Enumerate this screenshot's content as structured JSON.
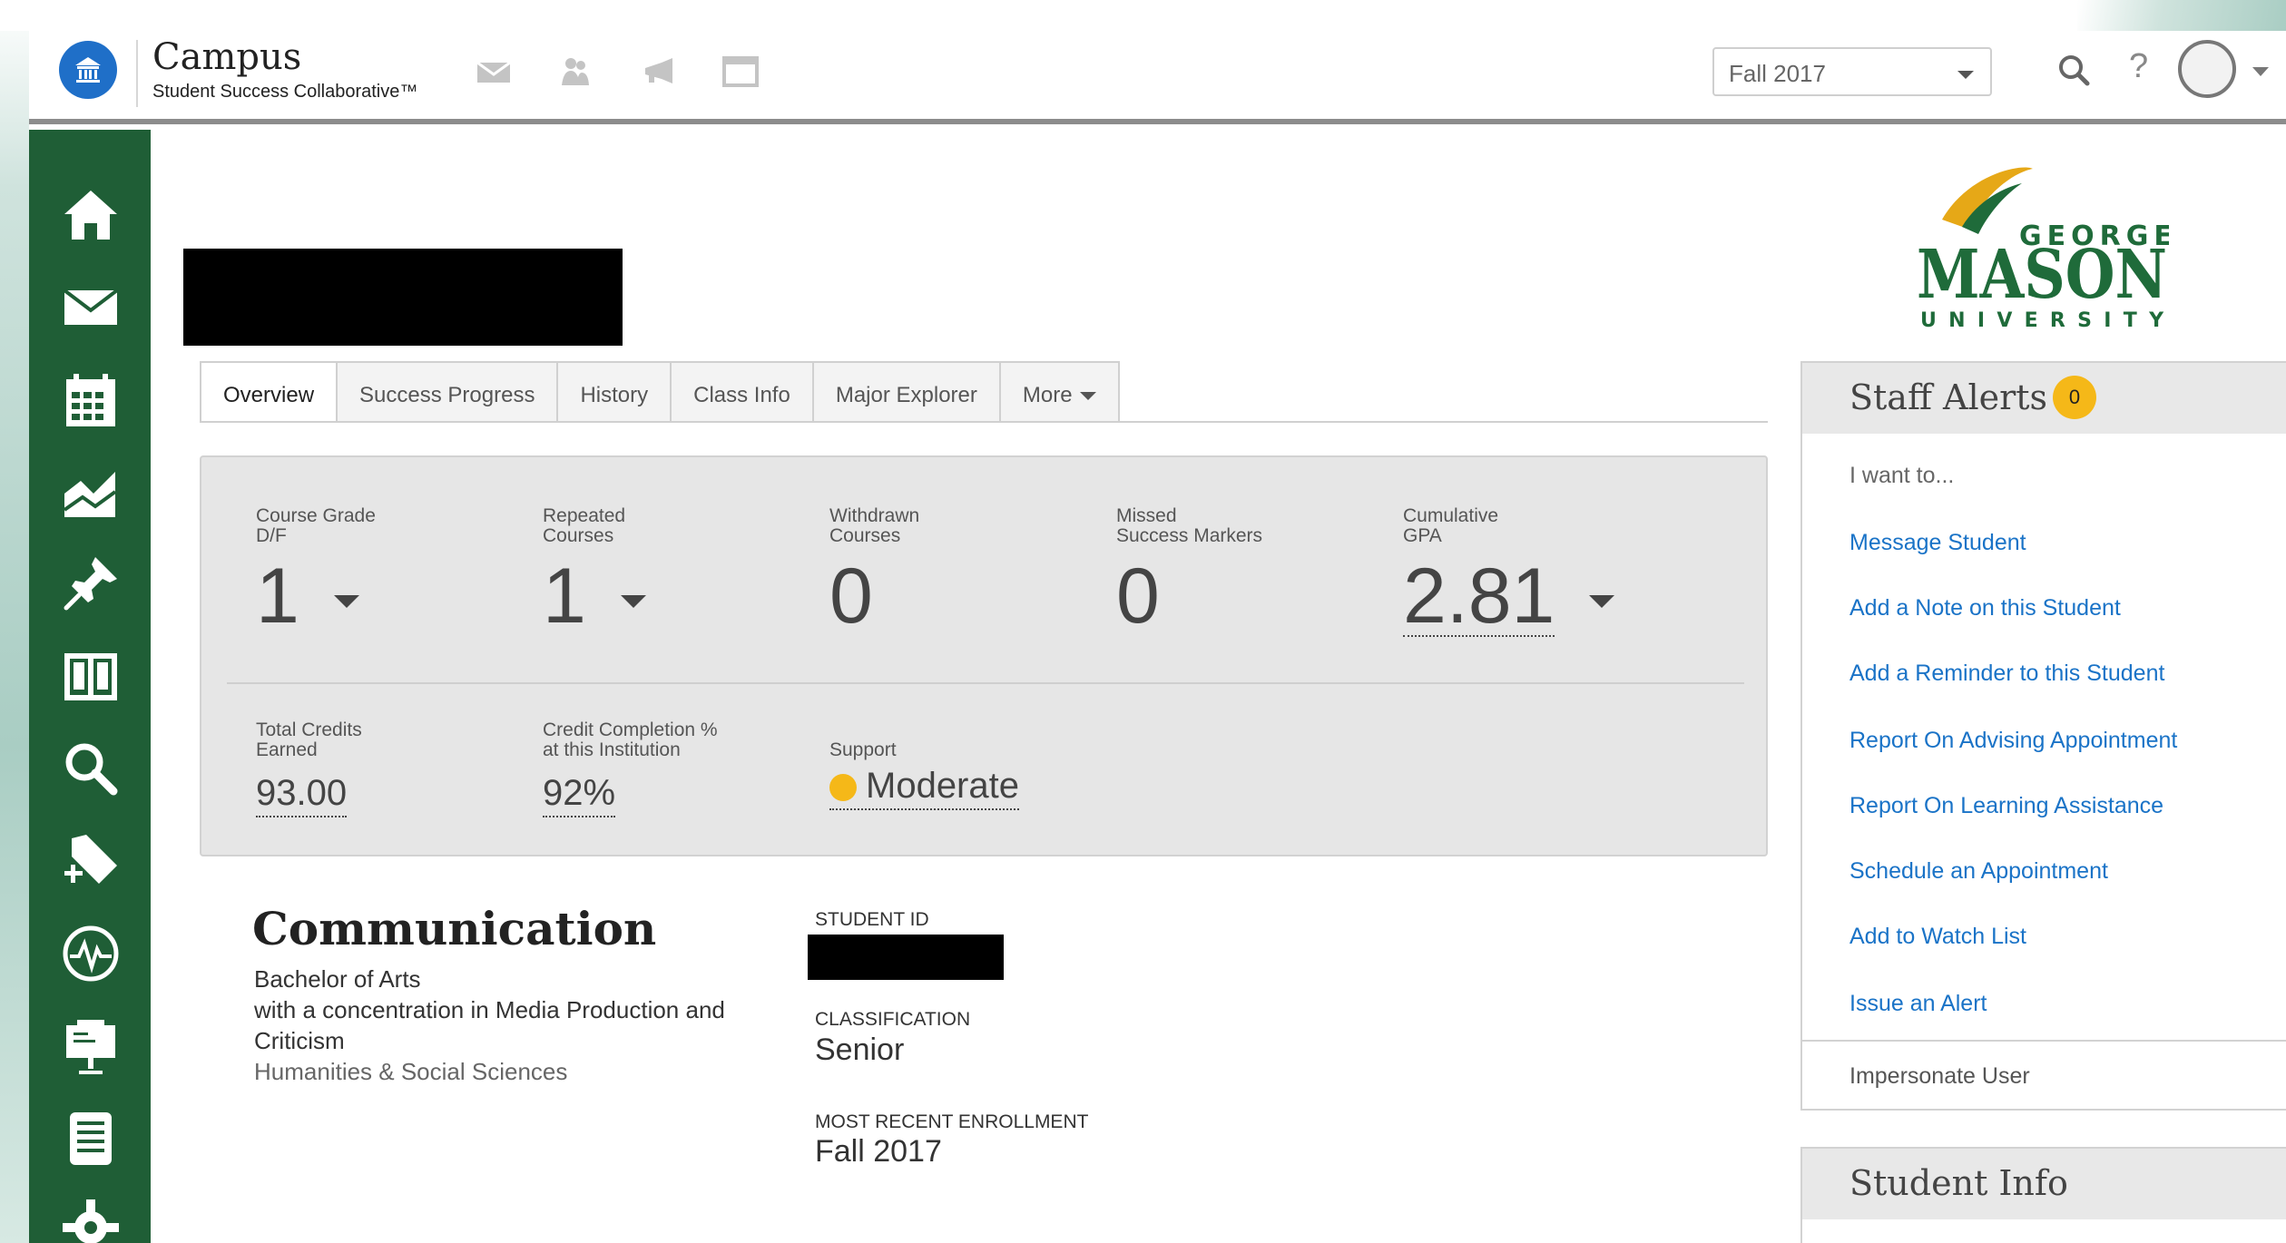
{
  "app": {
    "title": "Campus",
    "subtitle": "Student Success Collaborative™"
  },
  "header": {
    "icons": [
      "mail-icon",
      "people-icon",
      "megaphone-icon",
      "window-icon"
    ],
    "term_select": {
      "value": "Fall 2017"
    },
    "help_label": "?"
  },
  "sidebar": {
    "items": [
      "home-icon",
      "mail-icon",
      "calendar-icon",
      "chart-icon",
      "pin-icon",
      "book-icon",
      "search-icon",
      "add-tag-icon",
      "pulse-icon",
      "presentation-icon",
      "document-icon",
      "settings-icon"
    ]
  },
  "tabs": [
    {
      "label": "Overview",
      "active": true
    },
    {
      "label": "Success Progress"
    },
    {
      "label": "History"
    },
    {
      "label": "Class Info"
    },
    {
      "label": "Major Explorer"
    },
    {
      "label": "More"
    }
  ],
  "stats": {
    "course_grade": {
      "label1": "Course Grade",
      "label2": "D/F",
      "value": "1"
    },
    "repeated": {
      "label1": "Repeated",
      "label2": "Courses",
      "value": "1"
    },
    "withdrawn": {
      "label1": "Withdrawn",
      "label2": "Courses",
      "value": "0"
    },
    "missed": {
      "label1": "Missed",
      "label2": "Success Markers",
      "value": "0"
    },
    "gpa": {
      "label1": "Cumulative",
      "label2": "GPA",
      "value": "2.81"
    },
    "credits": {
      "label1": "Total Credits",
      "label2": "Earned",
      "value": "93.00"
    },
    "completion": {
      "label1": "Credit Completion %",
      "label2": "at this Institution",
      "value": "92%"
    },
    "support": {
      "label": "Support",
      "value": "Moderate",
      "color": "#f5b818"
    }
  },
  "major": {
    "title": "Communication",
    "degree": "Bachelor of Arts",
    "concentration_line1": "with a concentration in Media Production and",
    "concentration_line2": "Criticism",
    "college": "Humanities & Social Sciences"
  },
  "student": {
    "id_label": "STUDENT ID",
    "classification_label": "CLASSIFICATION",
    "classification": "Senior",
    "enrollment_label": "MOST RECENT ENROLLMENT",
    "enrollment": "Fall 2017"
  },
  "university_logo": {
    "line1": "GEORGE",
    "line2": "MASON",
    "line3": "UNIVERSITY",
    "colors": {
      "green": "#1f6b3a",
      "gold": "#e6a817"
    }
  },
  "staff_alerts": {
    "title": "Staff Alerts",
    "count": "0",
    "intro": "I want to...",
    "actions": [
      "Message Student",
      "Add a Note on this Student",
      "Add a Reminder to this Student",
      "Report On Advising Appointment",
      "Report On Learning Assistance",
      "Schedule an Appointment",
      "Add to Watch List",
      "Issue an Alert"
    ],
    "impersonate": "Impersonate User"
  },
  "student_info": {
    "title": "Student Info"
  },
  "colors": {
    "sidebar": "#1f5e36",
    "link": "#1a73c7",
    "accent_badge": "#f5b818"
  }
}
